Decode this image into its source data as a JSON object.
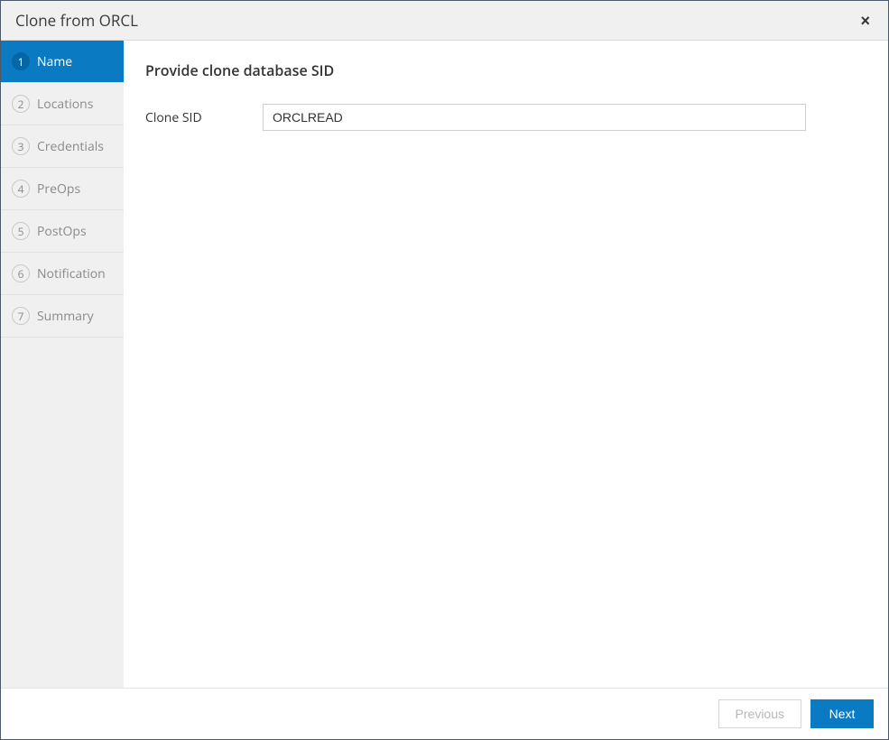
{
  "header": {
    "title": "Clone from ORCL",
    "close_label": "×"
  },
  "wizard": {
    "steps": [
      {
        "num": "1",
        "label": "Name",
        "active": true
      },
      {
        "num": "2",
        "label": "Locations",
        "active": false
      },
      {
        "num": "3",
        "label": "Credentials",
        "active": false
      },
      {
        "num": "4",
        "label": "PreOps",
        "active": false
      },
      {
        "num": "5",
        "label": "PostOps",
        "active": false
      },
      {
        "num": "6",
        "label": "Notification",
        "active": false
      },
      {
        "num": "7",
        "label": "Summary",
        "active": false
      }
    ]
  },
  "content": {
    "heading": "Provide clone database SID",
    "clone_sid_label": "Clone SID",
    "clone_sid_value": "ORCLREAD"
  },
  "footer": {
    "previous_label": "Previous",
    "next_label": "Next"
  }
}
